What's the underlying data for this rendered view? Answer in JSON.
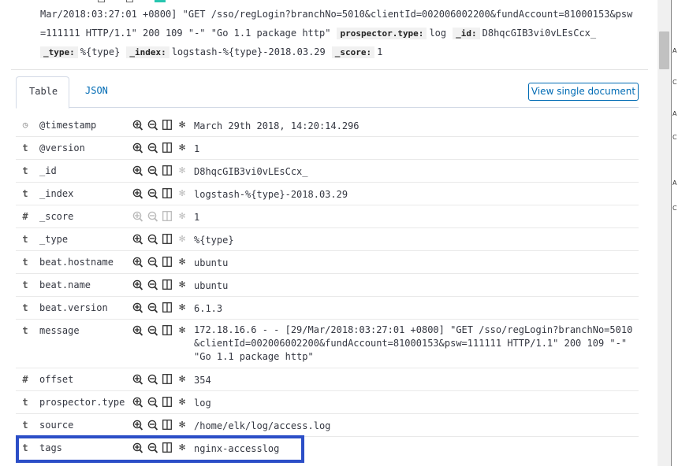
{
  "source_preview": {
    "lines": [
      {
        "text": "Mar/2018:03:27:01 +0800] \"GET /sso/regLogin?branchNo=5010&clientId=002006002200&fundAccount=81000153&psw"
      },
      {
        "text": "=111111 HTTP/1.1\" 200 109 \"-\" \"Go 1.1 package http\"",
        "pairs": [
          {
            "k": "prospector.type:",
            "v": "log"
          },
          {
            "k": "_id:",
            "v": "D8hqcGIB3vi0vLEsCcx_"
          }
        ]
      },
      {
        "pairs": [
          {
            "k": "_type:",
            "v": "%{type}"
          },
          {
            "k": "_index:",
            "v": "logstash-%{type}-2018.03.29"
          },
          {
            "k": "_score:",
            "v": "1"
          }
        ]
      }
    ]
  },
  "tabs": [
    {
      "label": "Table",
      "active": true
    },
    {
      "label": "JSON",
      "active": false
    }
  ],
  "view_single_document": "View single document",
  "fields": [
    {
      "type": "clock-icon",
      "type_label": "◷",
      "name": "@timestamp",
      "value": "March 29th 2018, 14:20:14.296",
      "filter_enabled": true,
      "toggle_enabled": true
    },
    {
      "type": "string",
      "type_label": "t",
      "name": "@version",
      "value": "1",
      "filter_enabled": true,
      "toggle_enabled": true
    },
    {
      "type": "string",
      "type_label": "t",
      "name": "_id",
      "value": "D8hqcGIB3vi0vLEsCcx_",
      "filter_enabled": true,
      "toggle_enabled": false
    },
    {
      "type": "string",
      "type_label": "t",
      "name": "_index",
      "value": "logstash-%{type}-2018.03.29",
      "filter_enabled": true,
      "toggle_enabled": false
    },
    {
      "type": "number",
      "type_label": "#",
      "name": "_score",
      "value": "1",
      "filter_enabled": false,
      "toggle_enabled": false
    },
    {
      "type": "string",
      "type_label": "t",
      "name": "_type",
      "value": "%{type}",
      "filter_enabled": true,
      "toggle_enabled": false
    },
    {
      "type": "string",
      "type_label": "t",
      "name": "beat.hostname",
      "value": "ubuntu",
      "filter_enabled": true,
      "toggle_enabled": true
    },
    {
      "type": "string",
      "type_label": "t",
      "name": "beat.name",
      "value": "ubuntu",
      "filter_enabled": true,
      "toggle_enabled": true
    },
    {
      "type": "string",
      "type_label": "t",
      "name": "beat.version",
      "value": "6.1.3",
      "filter_enabled": true,
      "toggle_enabled": true
    },
    {
      "type": "string",
      "type_label": "t",
      "name": "message",
      "value_lines": [
        "172.18.16.6 - - [29/Mar/2018:03:27:01 +0800] \"GET /sso/regLogin?branchNo=5010",
        "&clientId=002006002200&fundAccount=81000153&psw=111111 HTTP/1.1\" 200 109 \"-\"",
        " \"Go 1.1 package http\""
      ],
      "filter_enabled": true,
      "toggle_enabled": true
    },
    {
      "type": "number",
      "type_label": "#",
      "name": "offset",
      "value": "354",
      "filter_enabled": true,
      "toggle_enabled": true
    },
    {
      "type": "string",
      "type_label": "t",
      "name": "prospector.type",
      "value": "log",
      "filter_enabled": true,
      "toggle_enabled": true
    },
    {
      "type": "string",
      "type_label": "t",
      "name": "source",
      "value": "/home/elk/log/access.log",
      "filter_enabled": true,
      "toggle_enabled": true
    },
    {
      "type": "string",
      "type_label": "t",
      "name": "tags",
      "value": "nginx-accesslog",
      "filter_enabled": true,
      "toggle_enabled": true
    }
  ],
  "action_icons": [
    "magnify-plus-icon",
    "magnify-minus-icon",
    "column-toggle-icon",
    "asterisk-filter-icon"
  ],
  "colors": {
    "accent": "#006bb4",
    "highlight": "#2b4ec7",
    "scroll_thumb": "#c1c1c1"
  }
}
